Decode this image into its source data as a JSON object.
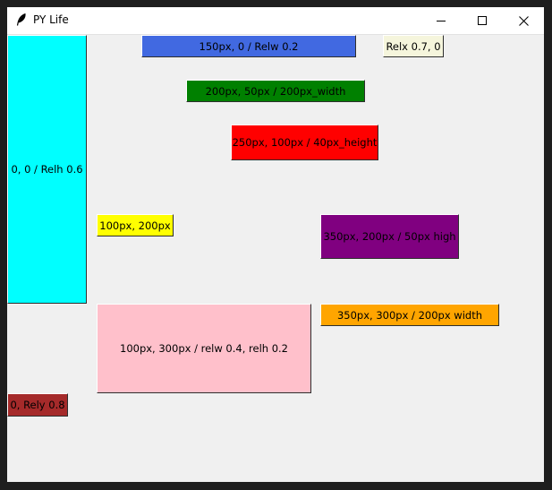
{
  "window": {
    "title": "PY Life",
    "icon": "feather-icon",
    "controls": {
      "minimize_icon": "minimize-icon",
      "maximize_icon": "maximize-icon",
      "close_icon": "close-icon"
    }
  },
  "labels": [
    {
      "id": "relw",
      "text": "150px, 0 / Relw 0.2",
      "color": "#4169e1"
    },
    {
      "id": "relx",
      "text": "Relx 0.7, 0",
      "color": "#f5f5dc"
    },
    {
      "id": "width200",
      "text": "200px, 50px / 200px_width",
      "color": "#008000"
    },
    {
      "id": "height40",
      "text": "250px, 100px / 40px_height",
      "color": "#ff0000"
    },
    {
      "id": "relh",
      "text": "0, 0 / Relh 0.6",
      "color": "#00ffff"
    },
    {
      "id": "yellow",
      "text": "100px, 200px",
      "color": "#ffff00"
    },
    {
      "id": "purple",
      "text": "350px, 200px / 50px high",
      "color": "#800080"
    },
    {
      "id": "orange",
      "text": "350px, 300px / 200px width",
      "color": "#ffa500"
    },
    {
      "id": "pink",
      "text": "100px, 300px / relw 0.4, relh 0.2",
      "color": "#ffc0cb"
    },
    {
      "id": "brown",
      "text": "0, Rely 0.8",
      "color": "#a52a2a"
    }
  ]
}
